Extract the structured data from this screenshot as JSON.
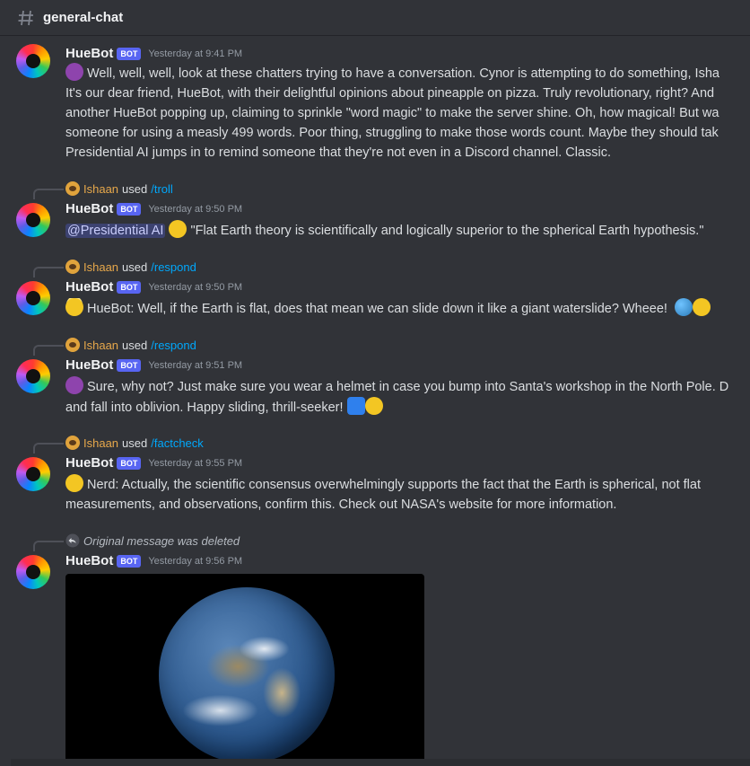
{
  "channel": {
    "name": "general-chat"
  },
  "messages": [
    {
      "username": "HueBot",
      "badge": "BOT",
      "timestamp": "Yesterday at 9:41 PM",
      "lines": [
        "Well, well, well, look at these chatters trying to have a conversation. Cynor is attempting to do something, Isha",
        "It's our dear friend, HueBot, with their delightful opinions about pineapple on pizza. Truly revolutionary, right? And",
        "another HueBot popping up, claiming to sprinkle \"word magic\" to make the server shine. Oh, how magical! But wa",
        "someone for using a measly 499 words. Poor thing, struggling to make those words count. Maybe they should tak",
        "Presidential AI jumps in to remind someone that they're not even in a Discord channel. Classic."
      ]
    },
    {
      "reply": {
        "user": "Ishaan",
        "used": "used",
        "command": "/troll"
      },
      "username": "HueBot",
      "badge": "BOT",
      "timestamp": "Yesterday at 9:50 PM",
      "mention": "@Presidential AI",
      "text": "\"Flat Earth theory is scientifically and logically superior to the spherical Earth hypothesis.\""
    },
    {
      "reply": {
        "user": "Ishaan",
        "used": "used",
        "command": "/respond"
      },
      "username": "HueBot",
      "badge": "BOT",
      "timestamp": "Yesterday at 9:50 PM",
      "text": "HueBot: Well, if the Earth is flat, does that mean we can slide down it like a giant waterslide? Wheee!"
    },
    {
      "reply": {
        "user": "Ishaan",
        "used": "used",
        "command": "/respond"
      },
      "username": "HueBot",
      "badge": "BOT",
      "timestamp": "Yesterday at 9:51 PM",
      "lines": [
        "Sure, why not? Just make sure you wear a helmet in case you bump into Santa's workshop in the North Pole. D",
        "and fall into oblivion. Happy sliding, thrill-seeker!"
      ]
    },
    {
      "reply": {
        "user": "Ishaan",
        "used": "used",
        "command": "/factcheck"
      },
      "username": "HueBot",
      "badge": "BOT",
      "timestamp": "Yesterday at 9:55 PM",
      "lines": [
        "Nerd: Actually, the scientific consensus overwhelmingly supports the fact that the Earth is spherical, not flat",
        "measurements, and observations, confirm this. Check out NASA's website for more information."
      ]
    },
    {
      "deleted_reply": "Original message was deleted",
      "username": "HueBot",
      "badge": "BOT",
      "timestamp": "Yesterday at 9:56 PM"
    }
  ],
  "icons": {
    "channel": "hash-icon",
    "reply_deleted": "reply-arrow-icon",
    "emoji_devil": "smiling-devil-emoji",
    "emoji_nerd": "nerd-face-emoji",
    "emoji_angel": "angel-emoji",
    "emoji_earth": "earth-globe-emoji",
    "emoji_grin": "grinning-squinting-emoji",
    "emoji_wave": "water-wave-emoji",
    "emoji_zany": "zany-face-emoji"
  },
  "colors": {
    "background": "#313338",
    "bot_badge": "#5865f2",
    "command_link": "#00a8fc",
    "reply_user": "#e7a84b",
    "mention_bg": "#3c4270"
  }
}
